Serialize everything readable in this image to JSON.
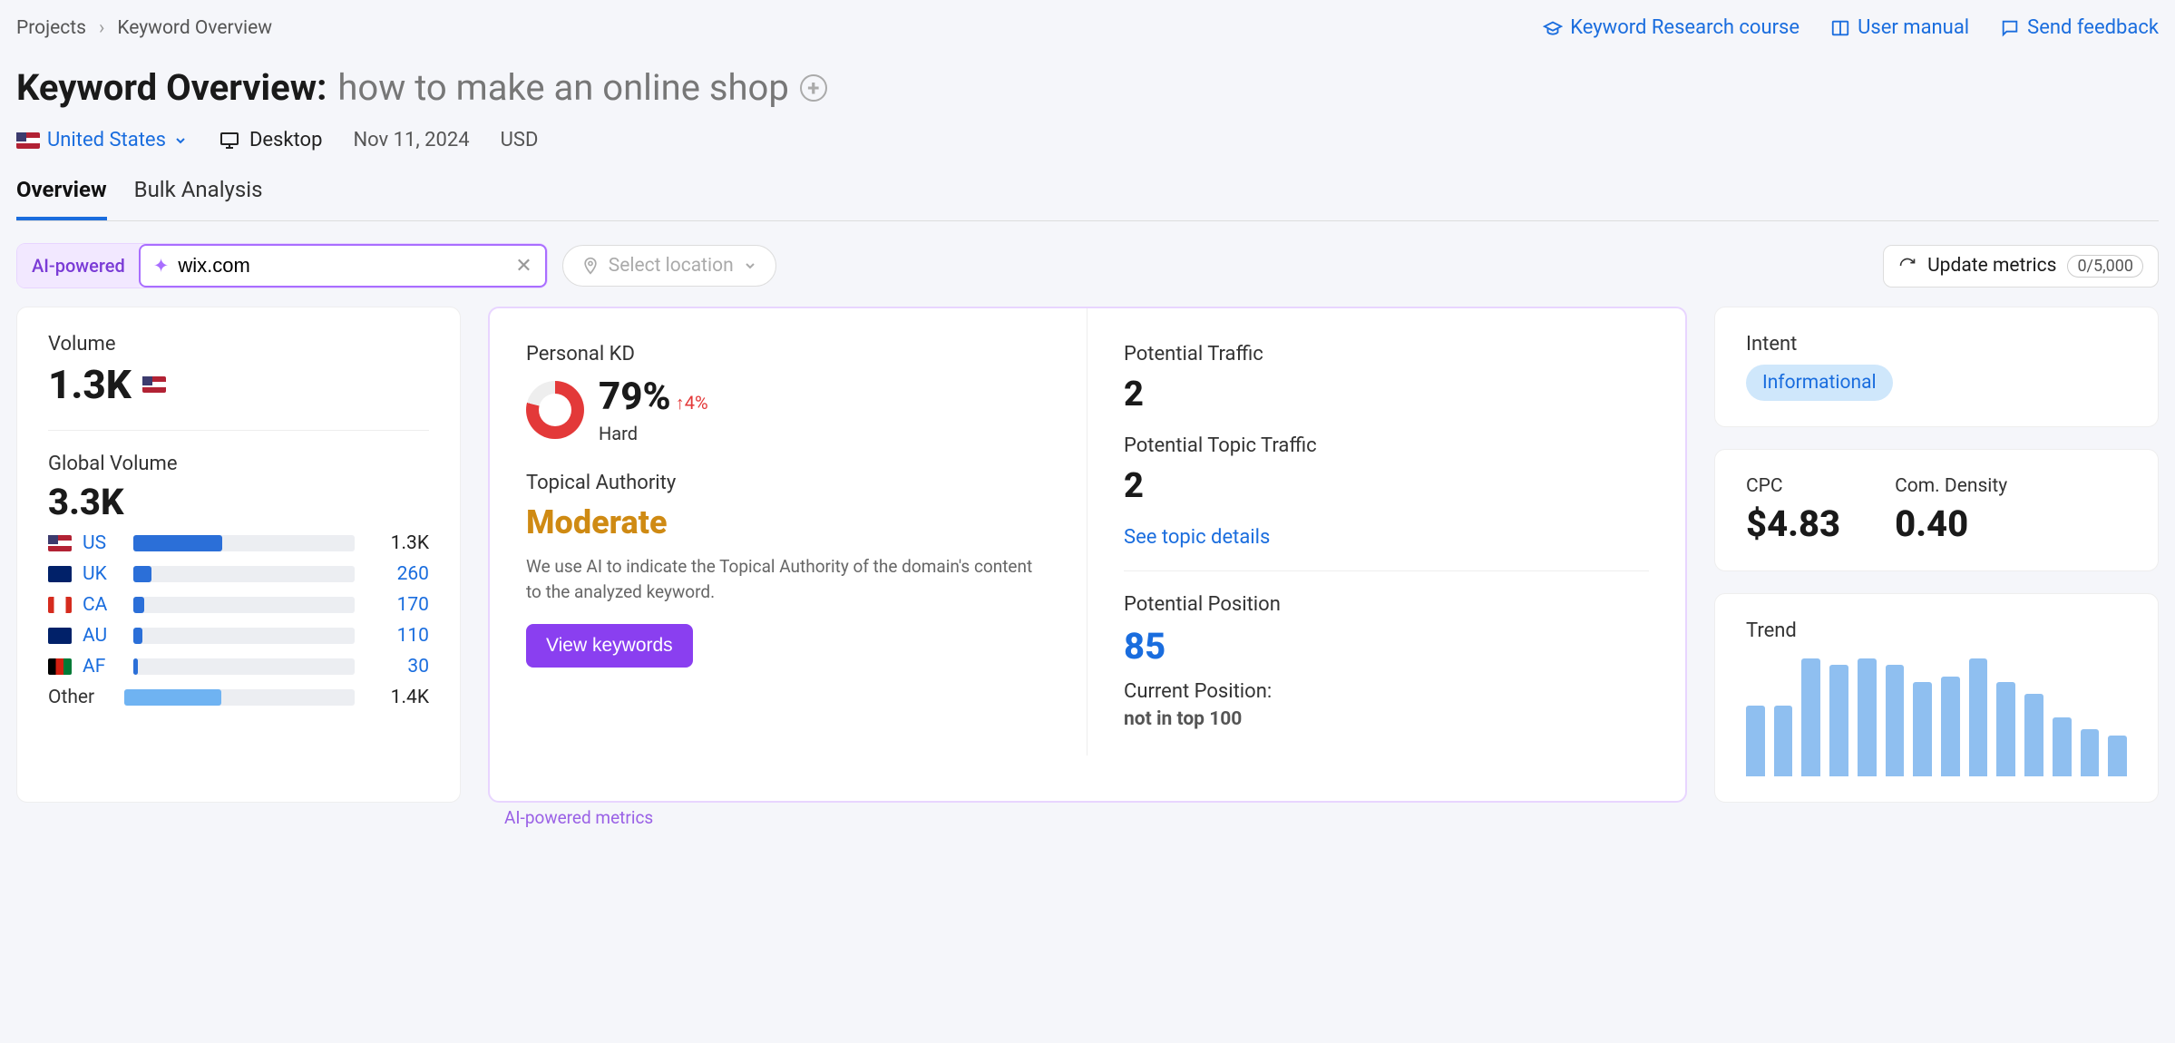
{
  "breadcrumb": {
    "projects": "Projects",
    "current": "Keyword Overview"
  },
  "toplinks": {
    "course": "Keyword Research course",
    "manual": "User manual",
    "feedback": "Send feedback"
  },
  "header": {
    "title": "Keyword Overview:",
    "keyword": "how to make an online shop"
  },
  "filters": {
    "region": "United States",
    "device": "Desktop",
    "date": "Nov 11, 2024",
    "currency": "USD"
  },
  "tabs": {
    "overview": "Overview",
    "bulk": "Bulk Analysis"
  },
  "controls": {
    "ai_badge": "AI-powered",
    "domain_value": "wix.com",
    "location_placeholder": "Select location",
    "update_label": "Update metrics",
    "update_counter": "0/5,000"
  },
  "volume": {
    "label": "Volume",
    "value": "1.3K",
    "global_label": "Global Volume",
    "global_value": "3.3K",
    "rows": [
      {
        "code": "US",
        "value": "1.3K",
        "pct": 40
      },
      {
        "code": "UK",
        "value": "260",
        "pct": 8
      },
      {
        "code": "CA",
        "value": "170",
        "pct": 5
      },
      {
        "code": "AU",
        "value": "110",
        "pct": 4
      },
      {
        "code": "AF",
        "value": "30",
        "pct": 2
      }
    ],
    "other": {
      "label": "Other",
      "value": "1.4K",
      "pct": 42
    }
  },
  "middle": {
    "kd_label": "Personal KD",
    "kd_value": "79%",
    "kd_delta": "4%",
    "kd_level": "Hard",
    "ta_label": "Topical Authority",
    "ta_value": "Moderate",
    "ta_desc": "We use AI to indicate the Topical Authority of the domain's content to the analyzed keyword.",
    "view_kw": "View keywords",
    "pt_label": "Potential Traffic",
    "pt_value": "2",
    "ptt_label": "Potential Topic Traffic",
    "ptt_value": "2",
    "topic_link": "See topic details",
    "pp_label": "Potential Position",
    "pp_value": "85",
    "cp_label": "Current Position:",
    "cp_value": "not in top 100",
    "footer": "AI-powered metrics"
  },
  "intent": {
    "label": "Intent",
    "value": "Informational"
  },
  "cpc": {
    "cpc_label": "CPC",
    "cpc_value": "$4.83",
    "cd_label": "Com. Density",
    "cd_value": "0.40"
  },
  "trend": {
    "label": "Trend",
    "bars": [
      60,
      60,
      100,
      95,
      100,
      95,
      80,
      85,
      100,
      80,
      70,
      50,
      40,
      35
    ]
  },
  "chart_data": {
    "type": "bar",
    "title": "Trend",
    "categories": [
      "1",
      "2",
      "3",
      "4",
      "5",
      "6",
      "7",
      "8",
      "9",
      "10",
      "11",
      "12",
      "13",
      "14"
    ],
    "values": [
      60,
      60,
      100,
      95,
      100,
      95,
      80,
      85,
      100,
      80,
      70,
      50,
      40,
      35
    ],
    "ylim": [
      0,
      100
    ]
  }
}
